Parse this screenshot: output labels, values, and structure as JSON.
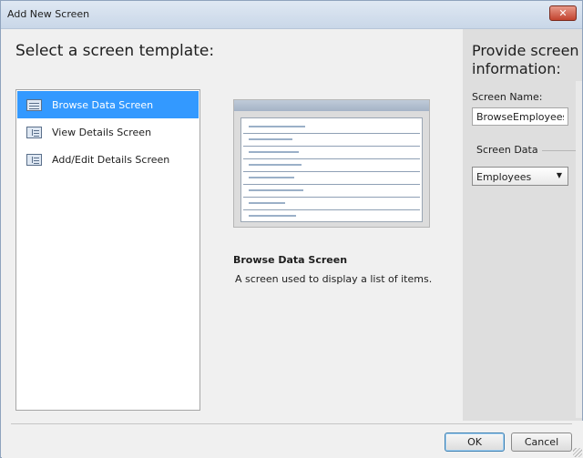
{
  "window": {
    "title": "Add New Screen",
    "close_glyph": "✕"
  },
  "main": {
    "heading": "Select a screen template:",
    "templates": [
      {
        "label": "Browse Data Screen",
        "icon": "grid-icon",
        "selected": true
      },
      {
        "label": "View Details Screen",
        "icon": "details-icon",
        "selected": false
      },
      {
        "label": "Add/Edit Details Screen",
        "icon": "details-icon",
        "selected": false
      }
    ],
    "selected_template": {
      "title": "Browse Data Screen",
      "description": "A screen used to display a list of items."
    }
  },
  "side": {
    "heading": "Provide screen information:",
    "screen_name_label": "Screen Name:",
    "screen_name_value": "BrowseEmployees",
    "screen_data_label": "Screen Data",
    "screen_data_value": "Employees",
    "dropdown_glyph": "▼"
  },
  "footer": {
    "ok_label": "OK",
    "cancel_label": "Cancel"
  },
  "colors": {
    "selection": "#3399ff",
    "side_panel": "#dedede",
    "titlebar": "#c9d7e8"
  }
}
